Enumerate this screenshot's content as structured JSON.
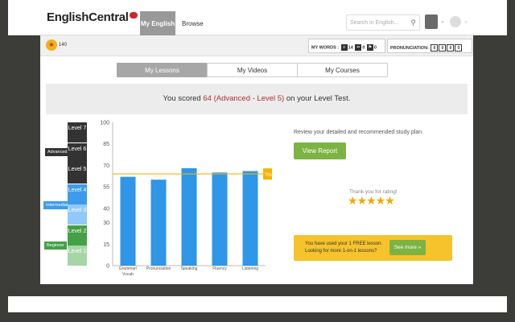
{
  "header": {
    "logo_text": "EnglishCentral",
    "nav": [
      {
        "label": "My English"
      },
      {
        "label": "Browse"
      }
    ],
    "search_placeholder": "Search in English...",
    "search_icon": "search-icon",
    "avatar_icon": "avatar-icon",
    "globe_icon": "globe-icon"
  },
  "subbar": {
    "coins": "140",
    "my_words_label": "MY WORDS :",
    "word_counts": [
      "14",
      "0",
      "0"
    ],
    "pronunciation_label": "PRONUNCIATION:",
    "pronunciation_buttons": [
      "0",
      "0",
      "0",
      "0"
    ]
  },
  "tabs": [
    {
      "label": "My Lessons"
    },
    {
      "label": "My Videos"
    },
    {
      "label": "My Courses"
    }
  ],
  "score": {
    "prefix": "You scored ",
    "highlight": "64 (Advanced - Level 5)",
    "suffix": " on your Level Test."
  },
  "levels": {
    "groups": [
      {
        "name": "Advanced",
        "color": "#333333"
      },
      {
        "name": "Intermediate",
        "color": "#3d9be9"
      },
      {
        "name": "Beginner",
        "color": "#43a047"
      }
    ],
    "items": [
      {
        "label": "Level 7",
        "color": "#333333"
      },
      {
        "label": "Level 6",
        "color": "#333333"
      },
      {
        "label": "Level 5",
        "color": "#333333"
      },
      {
        "label": "Level 4",
        "color": "#3d9be9"
      },
      {
        "label": "Level 3",
        "color": "#90caf9"
      },
      {
        "label": "Level 2",
        "color": "#43a047"
      },
      {
        "label": "Level 1",
        "color": "#a5d6a7"
      }
    ]
  },
  "chart_data": {
    "type": "bar",
    "categories": [
      "Grammar/\nVocab",
      "Pronunciation",
      "Speaking",
      "Fluency",
      "Listening"
    ],
    "values": [
      62,
      60,
      68,
      65,
      66
    ],
    "ylim": [
      0,
      100
    ],
    "yticks": [
      0,
      15,
      30,
      40,
      55,
      70,
      85,
      100
    ],
    "reference_line": {
      "value": 64,
      "label": "You're here",
      "color": "#f5b400"
    },
    "bar_color": "#2f96e8",
    "grid": false
  },
  "sidebar": {
    "review_text": "Review your detailed and recommended study plan.",
    "view_report": "View Report",
    "thanks_text": "Thank you for rating!",
    "rating": 5,
    "rating_max": 5,
    "promo_line1": "You have used your 1 FREE lesson.",
    "promo_line2": "Looking for more 1-on-1 lessons?",
    "promo_button": "See more »"
  }
}
